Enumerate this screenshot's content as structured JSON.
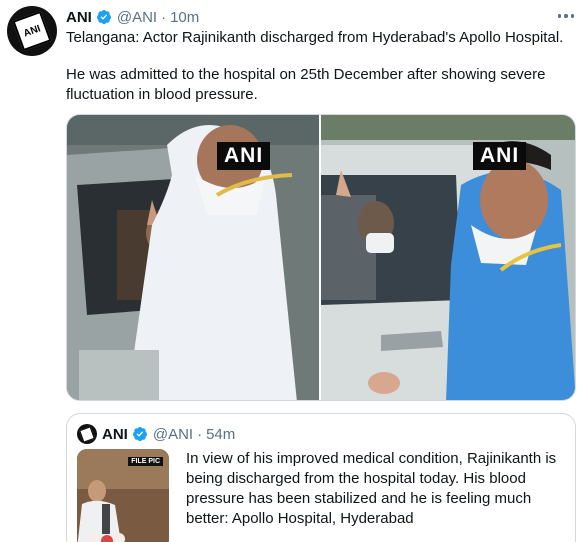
{
  "tweet": {
    "name": "ANI",
    "handle": "@ANI",
    "separator": "·",
    "time": "10m",
    "text_line1": "Telangana: Actor Rajinikanth discharged from Hyderabad's Apollo Hospital.",
    "text_line2": "He was admitted to the hospital on 25th December after showing severe fluctuation in blood pressure.",
    "watermark_left": "ANI",
    "watermark_right": "ANI"
  },
  "quote": {
    "name": "ANI",
    "handle": "@ANI",
    "separator": "·",
    "time": "54m",
    "thumb_label": "FILE PIC",
    "text": "In view of his improved medical condition, Rajinikanth is being discharged from the hospital today. His blood pressure has been stabilized and he is feeling much better: Apollo Hospital, Hyderabad"
  },
  "icons": {
    "verified": "verified-badge-icon",
    "more": "more-options-icon"
  },
  "colors": {
    "verified_blue": "#1da1f2",
    "secondary_text": "#5b7083",
    "border": "#cfd9de"
  }
}
